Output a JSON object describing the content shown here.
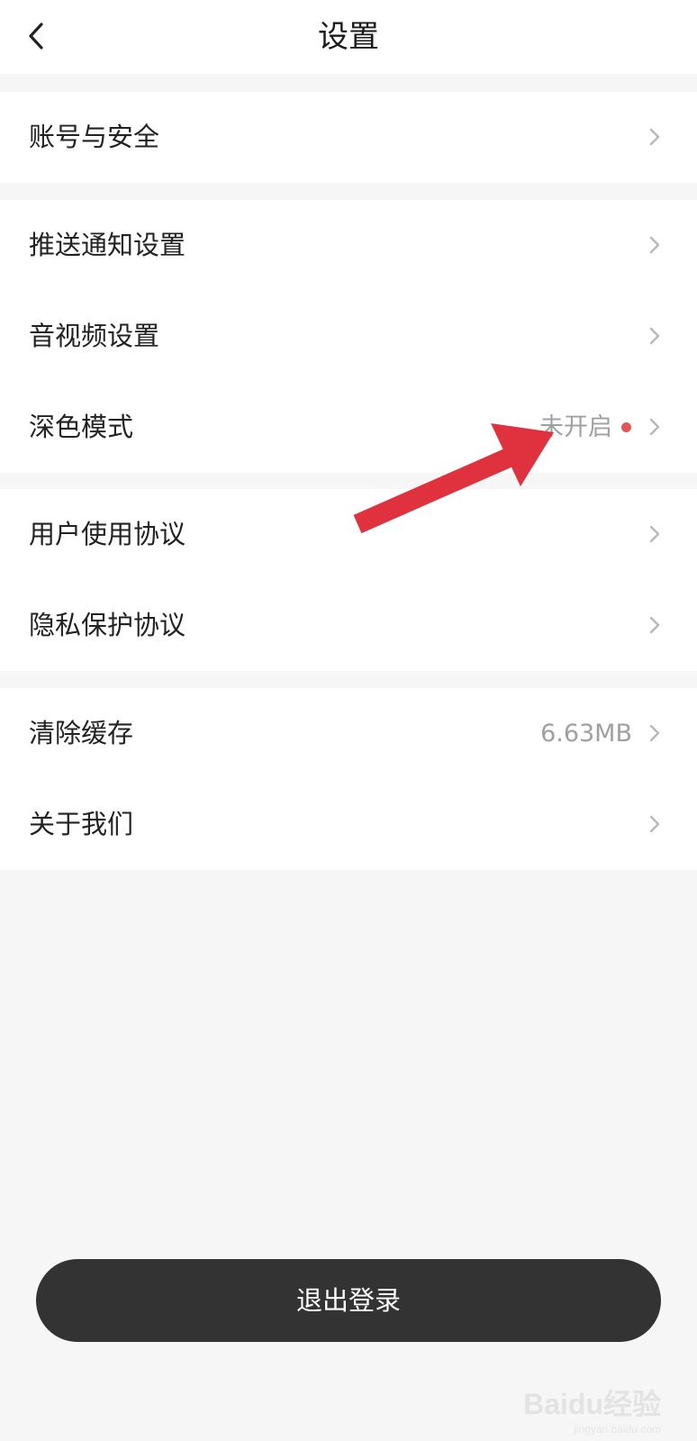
{
  "header": {
    "title": "设置",
    "back_icon": "chevron-left-icon"
  },
  "groups": [
    {
      "items": [
        {
          "label": "账号与安全",
          "value": ""
        }
      ]
    },
    {
      "items": [
        {
          "label": "推送通知设置",
          "value": ""
        },
        {
          "label": "音视频设置",
          "value": ""
        },
        {
          "label": "深色模式",
          "value": "未开启",
          "badge": "red-dot"
        }
      ]
    },
    {
      "items": [
        {
          "label": "用户使用协议",
          "value": ""
        },
        {
          "label": "隐私保护协议",
          "value": ""
        }
      ]
    },
    {
      "items": [
        {
          "label": "清除缓存",
          "value": "6.63MB"
        },
        {
          "label": "关于我们",
          "value": ""
        }
      ]
    }
  ],
  "logout_label": "退出登录",
  "annotation": {
    "type": "red-arrow",
    "color": "#e0313f"
  },
  "watermark": {
    "text": "Baidu经验",
    "sub": "jingyan.baidu.com"
  },
  "colors": {
    "background": "#f6f6f6",
    "row_background": "#ffffff",
    "logout_button": "#333333",
    "dot": "#e0575a",
    "secondary_text": "#a0a0a0"
  }
}
